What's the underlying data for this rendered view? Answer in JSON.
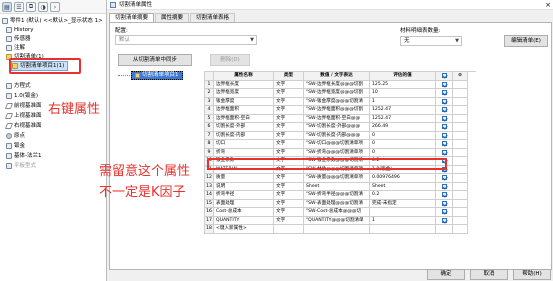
{
  "left_tree": {
    "items": [
      {
        "label": "零件1 (默认) <<默认>_显示状态 1>",
        "icon": "part-icon"
      },
      {
        "label": "History",
        "icon": "history-icon"
      },
      {
        "label": "传感器",
        "icon": "sensor-icon"
      },
      {
        "label": "注解",
        "icon": "annotation-icon"
      },
      {
        "label": "切割清单(1)",
        "icon": "cutlist-folder-icon"
      },
      {
        "label": "切割清单项目1(1)",
        "icon": "cutlist-item-icon"
      },
      {
        "label": "方程式",
        "icon": "equation-icon"
      },
      {
        "label": "1.0(钣金)",
        "icon": "material-icon"
      },
      {
        "label": "前视基准面",
        "icon": "plane-icon"
      },
      {
        "label": "上视基准面",
        "icon": "plane-icon"
      },
      {
        "label": "右视基准面",
        "icon": "plane-icon"
      },
      {
        "label": "原点",
        "icon": "origin-icon"
      },
      {
        "label": "钣金",
        "icon": "sheetmetal-icon"
      },
      {
        "label": "基体-法兰1",
        "icon": "base-flange-icon"
      },
      {
        "label": "平板型式",
        "icon": "flat-pattern-icon"
      }
    ]
  },
  "annotations": {
    "right_click": "右键属性",
    "note_line1": "需留意这个属性",
    "note_line2": "不一定是K因子"
  },
  "dialog": {
    "title": "切割清单属性",
    "close_glyph": "×",
    "tabs": [
      "切割清单摘要",
      "属性摘要",
      "切割清单表格"
    ],
    "config_label": "配置:",
    "config_value": "默认",
    "material_count_label": "材料明细表数量:",
    "material_count_value": "无",
    "edit_list_button": "编辑清单(E)",
    "sync_button": "从切割清单中同步",
    "delete_button": "删除(D)",
    "list_tree_item": "切割清单项目1",
    "ok_button": "确定",
    "cancel_button": "取消",
    "help_button": "帮助(H)"
  },
  "grid": {
    "headers": [
      "",
      "属性名称",
      "类型",
      "数值 / 文字表达",
      "评估的值",
      "",
      ""
    ],
    "rows": [
      {
        "num": "1",
        "name": "边界框长度",
        "type": "文字",
        "expr": "\"SW-边界框长度@@@切割",
        "value": "125.25",
        "checked": true
      },
      {
        "num": "2",
        "name": "边界框宽度",
        "type": "文字",
        "expr": "\"SW-边界框宽度@@@切割",
        "value": "10",
        "checked": true
      },
      {
        "num": "3",
        "name": "钣金厚度",
        "type": "文字",
        "expr": "\"SW-钣金厚度@@@切割清",
        "value": "1",
        "checked": true
      },
      {
        "num": "4",
        "name": "边界框面积",
        "type": "文字",
        "expr": "\"SW-边界框面积@@@切割",
        "value": "1252.47",
        "checked": true
      },
      {
        "num": "5",
        "name": "边界框面积-空白",
        "type": "文字",
        "expr": "\"SW-边界框面积-空白@@",
        "value": "1252.47",
        "checked": true
      },
      {
        "num": "6",
        "name": "切割长度-外部",
        "type": "文字",
        "expr": "\"SW-切割长度-外部@@@",
        "value": "266.49",
        "checked": true
      },
      {
        "num": "7",
        "name": "切割长度-内部",
        "type": "文字",
        "expr": "\"SW-切割长度-内部@@@",
        "value": "0",
        "checked": true
      },
      {
        "num": "8",
        "name": "切口",
        "type": "文字",
        "expr": "\"SW-切口@@@切割清单项",
        "value": "0",
        "checked": true
      },
      {
        "num": "9",
        "name": "折弯",
        "type": "文字",
        "expr": "\"SW-折弯@@@切割清单项",
        "value": "0",
        "checked": true
      },
      {
        "num": "10",
        "name": "钣金系数",
        "type": "文字",
        "expr": "\"SW-钣金系数@@@切割清",
        "value": "0.2",
        "checked": true
      },
      {
        "num": "11",
        "name": "MATERIAL",
        "type": "文字",
        "expr": "\"SW-材质@@@切割清单项",
        "value": "1.0(钣金)",
        "checked": true
      },
      {
        "num": "12",
        "name": "质量",
        "type": "文字",
        "expr": "\"SW-质量@@@切割清单项",
        "value": "0.00976496",
        "checked": true
      },
      {
        "num": "13",
        "name": "说明",
        "type": "文字",
        "expr": "Sheet",
        "value": "Sheet",
        "checked": true
      },
      {
        "num": "14",
        "name": "折弯半径",
        "type": "文字",
        "expr": "\"SW-折弯半径@@@切割清",
        "value": "0.2",
        "checked": true
      },
      {
        "num": "15",
        "name": "表面处理",
        "type": "文字",
        "expr": "\"SW-表面处理@@@切割清",
        "value": "完成-未指定",
        "checked": true
      },
      {
        "num": "16",
        "name": "Cost-总成本",
        "type": "文字",
        "expr": "\"SW-Cost-总成本@@@切",
        "value": "",
        "checked": true
      },
      {
        "num": "17",
        "name": "QUANTITY",
        "type": "文字",
        "expr": "\"QUANTITY@@@切割清单",
        "value": "1",
        "checked": true
      },
      {
        "num": "18",
        "name": "<键入新属性>",
        "type": "",
        "expr": "",
        "value": "",
        "checked": false
      }
    ]
  },
  "colors": {
    "annotation_red": "#e8302d",
    "check_blue": "#2f6fc0"
  }
}
